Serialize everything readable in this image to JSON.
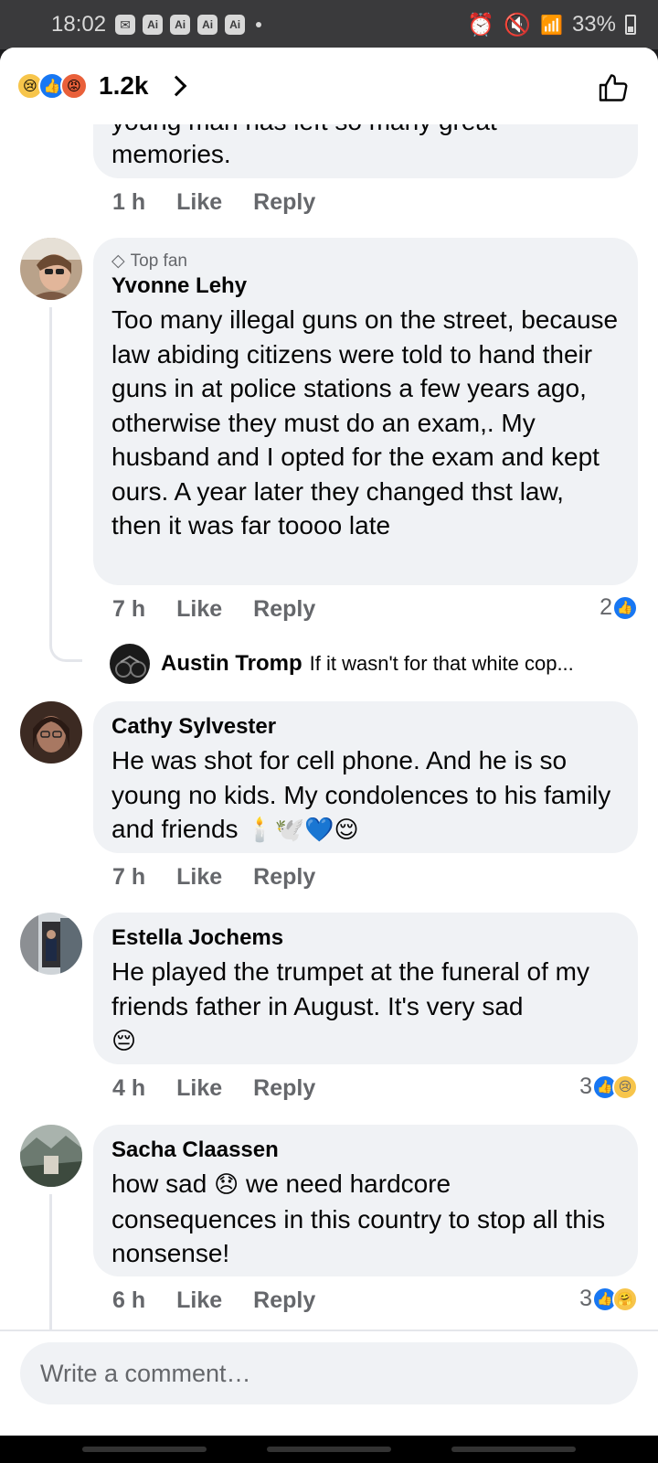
{
  "status": {
    "time": "18:02",
    "notif_icons": [
      "Ai",
      "Ai",
      "Ai",
      "Ai"
    ],
    "battery": "33%"
  },
  "header": {
    "reaction_count": "1.2k"
  },
  "colors": {
    "accent": "#1877f2",
    "bubble": "#f0f2f5",
    "meta": "#65676b"
  },
  "partial_comment": {
    "text_top": "young man has left so many great",
    "text": "memories.",
    "time": "1 h",
    "like": "Like",
    "reply": "Reply"
  },
  "comments": [
    {
      "badge": "Top fan",
      "author": "Yvonne Lehy",
      "text": "Too many illegal guns on the street, because law abiding citizens were told to hand their guns in at police stations a few years ago, otherwise they must do an exam,. My husband and I opted for the exam and kept ours. A year later they changed thst law, then it was far toooo late",
      "time": "7 h",
      "like": "Like",
      "reply": "Reply",
      "reactions": "2",
      "reply_preview": {
        "author": "Austin Tromp",
        "text": "If it wasn't for that white cop..."
      }
    },
    {
      "author": "Cathy Sylvester",
      "text": "He was shot for cell phone.  And he is so young no kids.    My condolences to his family and friends",
      "emojis": "🕯️🕊️💙😌",
      "time": "7 h",
      "like": "Like",
      "reply": "Reply"
    },
    {
      "author": "Estella Jochems",
      "text": "He played the trumpet at the funeral of my friends father in August. It's very sad",
      "emojis": "😔",
      "time": "4 h",
      "like": "Like",
      "reply": "Reply",
      "reactions": "3"
    },
    {
      "author": "Sacha Claassen",
      "text_before": "how sad",
      "emoji_inline": "😞",
      "text_after": "we need hardcore consequences in this country to stop all this nonsense!",
      "time": "6 h",
      "like": "Like",
      "reply": "Reply",
      "reactions": "3"
    }
  ],
  "composer": {
    "placeholder": "Write a comment…"
  }
}
